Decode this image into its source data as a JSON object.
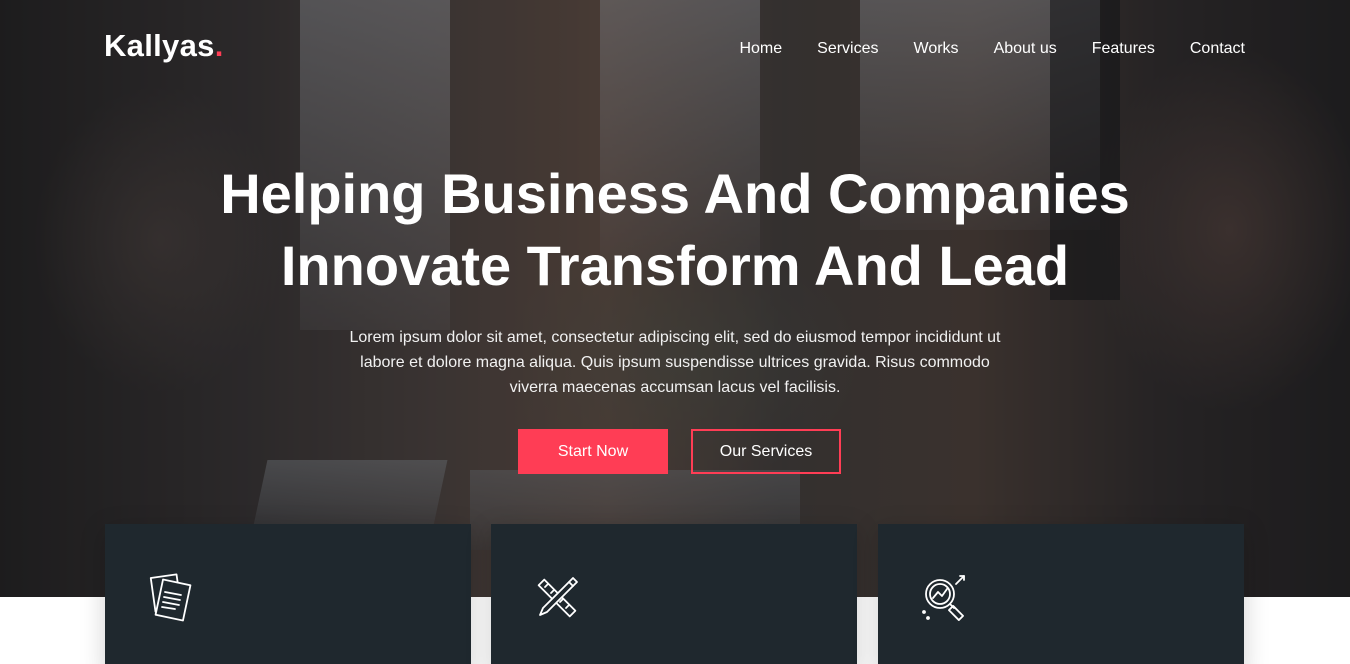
{
  "brand": {
    "name": "Kallyas",
    "dot": ".",
    "accent_color": "#ff3d55"
  },
  "nav": {
    "items": [
      {
        "label": "Home"
      },
      {
        "label": "Services"
      },
      {
        "label": "Works"
      },
      {
        "label": "About us"
      },
      {
        "label": "Features"
      },
      {
        "label": "Contact"
      }
    ]
  },
  "hero": {
    "headline_line1": "Helping Business And Companies",
    "headline_line2": "Innovate Transform And Lead",
    "subtext_line1": "Lorem ipsum dolor sit amet, consectetur adipiscing elit, sed do eiusmod tempor incididunt ut",
    "subtext_line2": "labore et dolore magna aliqua. Quis ipsum suspendisse ultrices gravida. Risus commodo",
    "subtext_line3": "viverra maecenas accumsan lacus vel facilisis.",
    "primary_button": "Start Now",
    "secondary_button": "Our Services"
  },
  "cards": [
    {
      "icon": "document-icon",
      "title": ""
    },
    {
      "icon": "pencil-ruler-icon",
      "title": ""
    },
    {
      "icon": "magnifier-chart-icon",
      "title": ""
    }
  ],
  "colors": {
    "card_bg": "#1f282e",
    "accent": "#ff3d55"
  }
}
